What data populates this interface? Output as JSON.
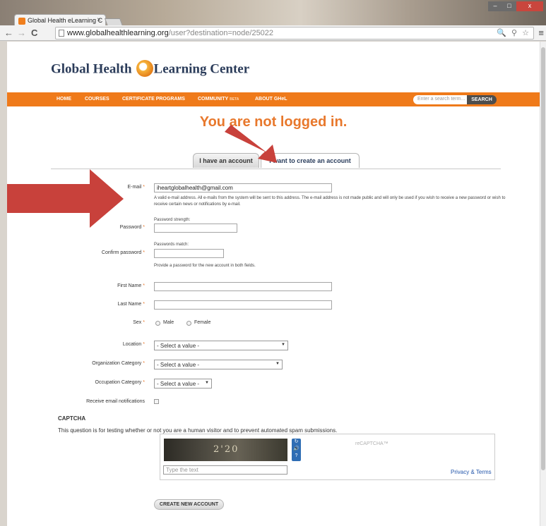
{
  "browser": {
    "tab_title": "Global Health eLearning C",
    "tab_close": "×",
    "url_domain": "www.globalhealthlearning.org",
    "url_path": "/user?destination=node/25022",
    "win_min": "–",
    "win_max": "□",
    "win_close": "x",
    "back_icon": "←",
    "forward_icon": "→",
    "reload_icon": "C",
    "omnibox_icons": "🔍 ⚲ ☆",
    "menu_icon": "≡"
  },
  "site": {
    "logo_left": "Global Health",
    "logo_right": "Learning Center",
    "nav": [
      {
        "label": "HOME"
      },
      {
        "label": "COURSES"
      },
      {
        "label": "CERTIFICATE PROGRAMS"
      },
      {
        "label": "COMMUNITY",
        "badge": "BETA"
      },
      {
        "label": "ABOUT GHeL"
      }
    ],
    "search_placeholder": "Enter a search term...",
    "search_button": "SEARCH"
  },
  "main": {
    "heading": "You are not logged in.",
    "tabs": [
      {
        "label": "I have an account"
      },
      {
        "label": "I want to create an account"
      }
    ]
  },
  "form": {
    "email_label": "E-mail",
    "email_value": "iheartglobalhealth@gmail.com",
    "email_desc": "A valid e-mail address. All e-mails from the system will be sent to this address. The e-mail address is not made public and will only be used if you wish to receive a new password or wish to receive certain news or notifications by e-mail.",
    "password_strength": "Password strength:",
    "password_label": "Password",
    "passwords_match": "Passwords match:",
    "confirm_label": "Confirm password",
    "password_desc": "Provide a password for the new account in both fields.",
    "first_name_label": "First Name",
    "last_name_label": "Last Name",
    "sex_label": "Sex",
    "sex_options": [
      "Male",
      "Female"
    ],
    "location_label": "Location",
    "location_value": "- Select a value -",
    "org_label": "Organization Category",
    "org_value": "- Select a value -",
    "occupation_label": "Occupation Category",
    "occupation_value": "- Select a value -",
    "notify_label": "Receive email notifications",
    "required_mark": "*",
    "select_arrow": "▼"
  },
  "captcha": {
    "title": "CAPTCHA",
    "description": "This question is for testing whether or not you are a human visitor and to prevent automated spam submissions.",
    "image_text": "2'20",
    "ctrl_icons": [
      "↻",
      "🔊",
      "?"
    ],
    "logo_text": "reCAPTCHA™",
    "input_placeholder": "Type the text",
    "privacy_link": "Privacy & Terms"
  },
  "submit": {
    "label": "CREATE NEW ACCOUNT"
  },
  "colors": {
    "brand_orange": "#ef7a1a",
    "arrow_red": "#c8413b"
  }
}
